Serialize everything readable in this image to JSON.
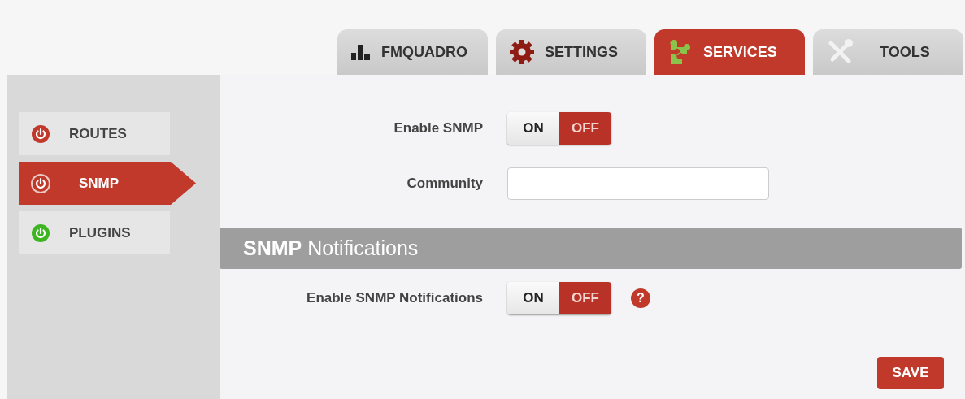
{
  "tabs": [
    {
      "label": "FMQUADRO",
      "kind": "bars",
      "selected": false
    },
    {
      "label": "SETTINGS",
      "kind": "gear",
      "selected": false
    },
    {
      "label": "SERVICES",
      "kind": "puzzle",
      "selected": true
    },
    {
      "label": "TOOLS",
      "kind": "tools",
      "selected": false
    }
  ],
  "sidebar": {
    "items": [
      {
        "label": "ROUTES",
        "color": "#c0392b",
        "selected": false
      },
      {
        "label": "SNMP",
        "color": "#c0392b",
        "selected": true
      },
      {
        "label": "PLUGINS",
        "color": "#3cb521",
        "selected": false
      }
    ]
  },
  "form": {
    "fields": [
      {
        "kind": "toggle",
        "label": "Enable SNMP",
        "on_label": "ON",
        "off_label": "OFF",
        "on": false
      },
      {
        "kind": "text",
        "label": "Community"
      }
    ]
  },
  "section": {
    "title": "**SNMP** Notifications",
    "fields": [
      {
        "kind": "toggle",
        "label": "Enable SNMP Notifications",
        "on_label": "ON",
        "off_label": "OFF",
        "on": false,
        "help": "?"
      }
    ]
  },
  "buttons": [
    "SAVE"
  ]
}
